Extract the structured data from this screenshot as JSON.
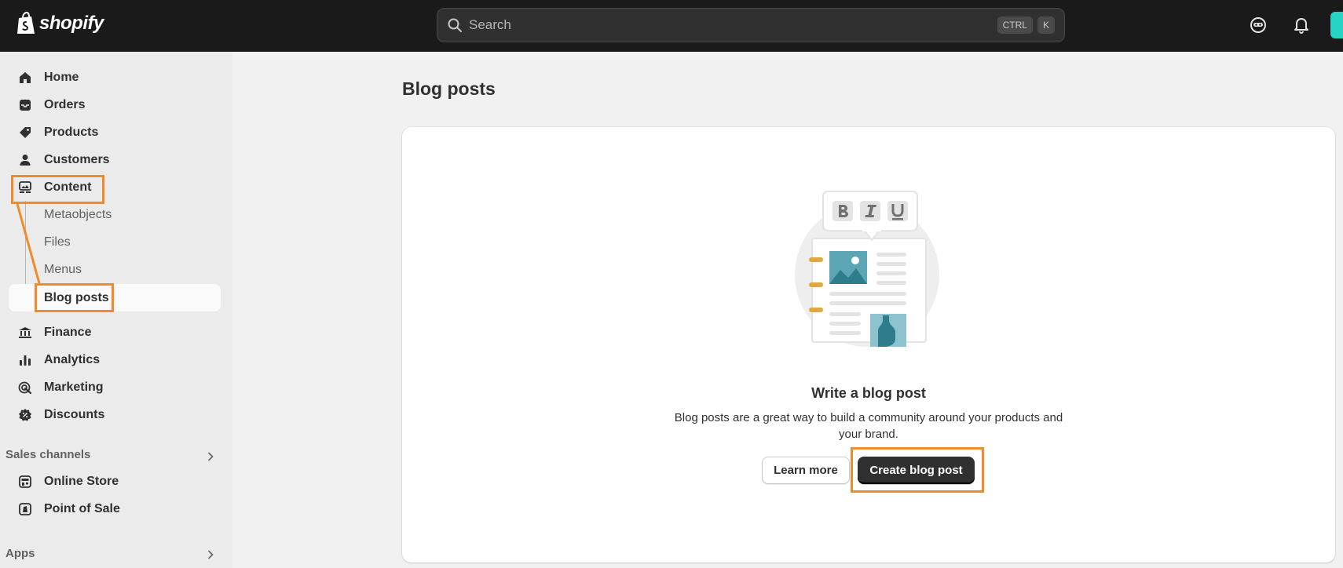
{
  "topbar": {
    "logo_text": "shopify",
    "search_placeholder": "Search",
    "shortcut_ctrl": "CTRL",
    "shortcut_key": "K"
  },
  "sidebar": {
    "main_items": [
      {
        "label": "Home",
        "icon": "home-icon"
      },
      {
        "label": "Orders",
        "icon": "orders-icon"
      },
      {
        "label": "Products",
        "icon": "tag-icon"
      },
      {
        "label": "Customers",
        "icon": "person-icon"
      },
      {
        "label": "Content",
        "icon": "content-icon"
      }
    ],
    "content_sub_items": [
      "Metaobjects",
      "Files",
      "Menus",
      "Blog posts"
    ],
    "more_items": [
      {
        "label": "Finance",
        "icon": "bank-icon"
      },
      {
        "label": "Analytics",
        "icon": "bar-chart-icon"
      },
      {
        "label": "Marketing",
        "icon": "target-icon"
      },
      {
        "label": "Discounts",
        "icon": "discount-icon"
      }
    ],
    "sales_channels_label": "Sales channels",
    "channels": [
      {
        "label": "Online Store",
        "icon": "store-icon"
      },
      {
        "label": "Point of Sale",
        "icon": "pos-icon"
      }
    ],
    "apps_label": "Apps"
  },
  "main": {
    "page_title": "Blog posts",
    "empty_state": {
      "title": "Write a blog post",
      "description": "Blog posts are a great way to build a community around your products and your brand.",
      "learn_more_label": "Learn more",
      "create_label": "Create blog post"
    }
  },
  "colors": {
    "topbar": "#1a1a1a",
    "highlight": "#f08a2b",
    "primary_button": "#303030",
    "accent_teal": "#25d4c4"
  }
}
